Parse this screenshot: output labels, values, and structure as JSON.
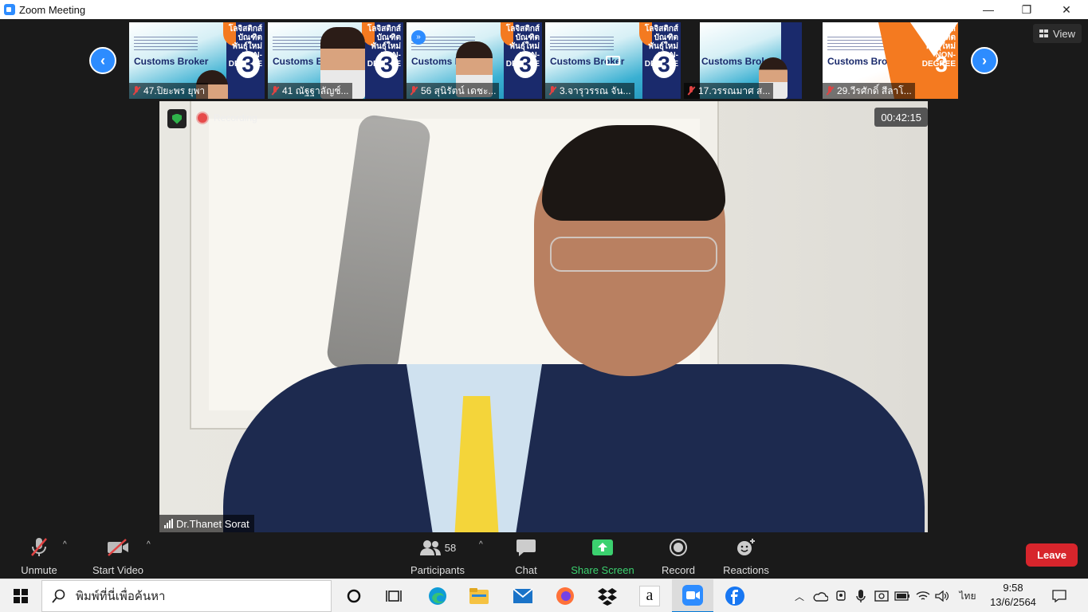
{
  "window": {
    "title": "Zoom Meeting",
    "minimize": "—",
    "restore": "❐",
    "close": "✕"
  },
  "gallery": {
    "view_label": "View",
    "prev_label": "‹",
    "next_label": "›",
    "thumb_common": {
      "title": "โลจิสติกส์ บัณฑิตพันธุ์ใหม่ NON-DEGREE",
      "course": "Customs Broker",
      "round": "3"
    },
    "thumbs": [
      {
        "name": "47.ปิยะพร ยุพา"
      },
      {
        "name": "41 ณัฐฐาลัญช์..."
      },
      {
        "name": "56 สุนิรัตน์ เดชะ..."
      },
      {
        "name": "3.จารุวรรณ จัน..."
      },
      {
        "name": "17.วรรณมาศ ส..."
      },
      {
        "name": "29.วีรศักดิ์ สีลาโ..."
      }
    ]
  },
  "main_video": {
    "recording_label": "Recording",
    "timer": "00:42:15",
    "speaker": "Dr.Thanet Sorat"
  },
  "controls": {
    "unmute": "Unmute",
    "start_video": "Start Video",
    "participants": "Participants",
    "participants_count": "58",
    "chat": "Chat",
    "share_screen": "Share Screen",
    "record": "Record",
    "reactions": "Reactions",
    "leave": "Leave",
    "caret": "^"
  },
  "taskbar": {
    "search_placeholder": "พิมพ์ที่นี่เพื่อค้นหา",
    "language": "ไทย",
    "time": "9:58",
    "date": "13/6/2564"
  },
  "colors": {
    "zoom_blue": "#2d8cff",
    "leave_red": "#d7252c",
    "share_green": "#3bd16f",
    "record_red": "#e64a4a"
  }
}
